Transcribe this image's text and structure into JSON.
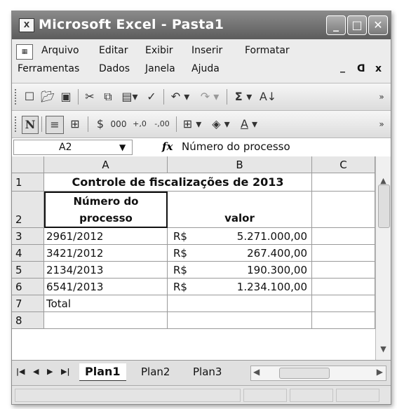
{
  "window": {
    "title": "Microsoft Excel - Pasta1",
    "app_icon": "excel-icon",
    "controls": [
      "minimize-icon",
      "maximize-icon",
      "close-icon"
    ]
  },
  "menu": {
    "items": [
      "Arquivo",
      "Editar",
      "Exibir",
      "Inserir",
      "Formatar",
      "Ferramentas",
      "Dados",
      "Janela",
      "Ajuda"
    ],
    "doc_controls": [
      "_",
      "ᗡ",
      "x"
    ]
  },
  "formula_bar": {
    "name_box": "A2",
    "fx_label": "fx",
    "content": "Número do processo"
  },
  "grid": {
    "columns": [
      "A",
      "B",
      "C"
    ],
    "rows": [
      "1",
      "2",
      "3",
      "4",
      "5",
      "6",
      "7",
      "8"
    ],
    "title": "Controle de fiscalizações de 2013",
    "header_a_line1": "Número do",
    "header_a_line2": "processo",
    "header_b": "valor",
    "data": [
      {
        "processo": "2961/2012",
        "currency": "R$",
        "valor": "5.271.000,00"
      },
      {
        "processo": "3421/2012",
        "currency": "R$",
        "valor": "267.400,00"
      },
      {
        "processo": "2134/2013",
        "currency": "R$",
        "valor": "190.300,00"
      },
      {
        "processo": "6541/2013",
        "currency": "R$",
        "valor": "1.234.100,00"
      }
    ],
    "total_label": "Total"
  },
  "sheets": {
    "tabs": [
      "Plan1",
      "Plan2",
      "Plan3"
    ],
    "active": "Plan1"
  }
}
